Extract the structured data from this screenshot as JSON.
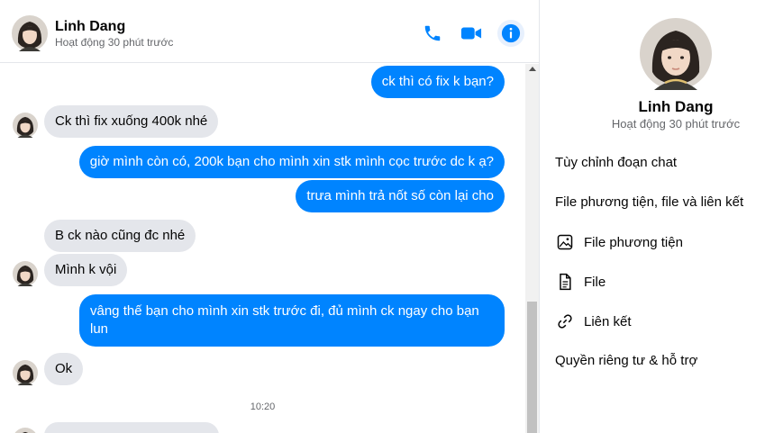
{
  "header": {
    "name": "Linh Dang",
    "status": "Hoạt động 30 phút trước",
    "icons": [
      "phone-icon",
      "video-camera-icon",
      "info-icon"
    ]
  },
  "colors": {
    "accent": "#0084ff",
    "incoming_bubble": "#e4e6eb",
    "muted_text": "#65676b"
  },
  "messages": [
    {
      "direction": "out",
      "text": "ck thì có fix k bạn?"
    },
    {
      "direction": "in",
      "text": "Ck thì fix xuống 400k nhé"
    },
    {
      "direction": "out",
      "text": "giờ mình còn có, 200k bạn cho mình xin stk mình cọc trước dc k ạ?"
    },
    {
      "direction": "out",
      "text": "trưa mình trả nốt số còn lại cho"
    },
    {
      "direction": "in",
      "text": "B ck nào cũng đc nhé"
    },
    {
      "direction": "in",
      "text": "Mình k vội"
    },
    {
      "direction": "out",
      "text": "vâng thế bạn cho mình xin stk trước đi, đủ mình ck ngay cho bạn lun"
    },
    {
      "direction": "in",
      "text": "Ok"
    }
  ],
  "timestamp": "10:20",
  "info_panel": {
    "name": "Linh Dang",
    "status": "Hoạt động 30 phút trước",
    "customize_chat": "Tùy chỉnh đoạn chat",
    "media_files_links": "File phương tiện, file và liên kết",
    "media": "File phương tiện",
    "files": "File",
    "links": "Liên kết",
    "privacy_support": "Quyền riêng tư & hỗ trợ"
  }
}
